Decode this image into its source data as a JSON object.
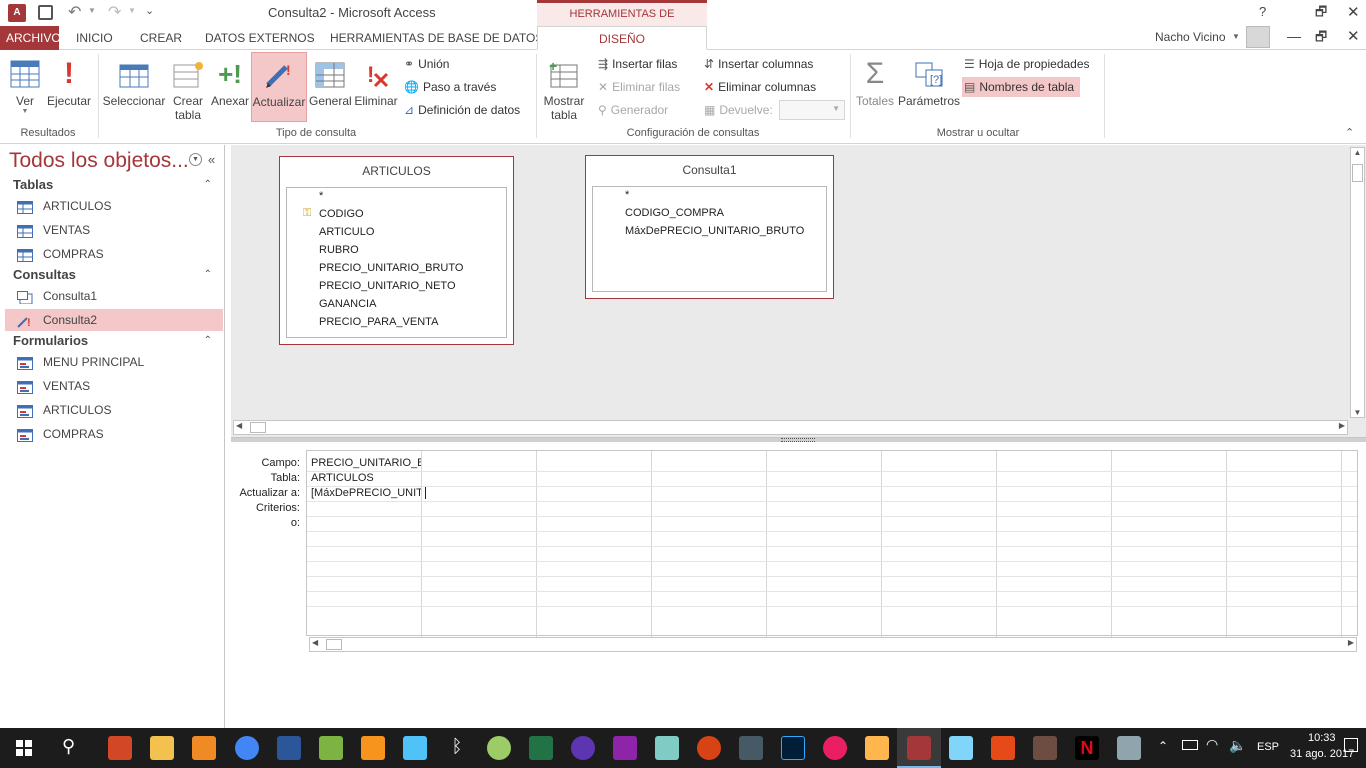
{
  "window": {
    "title": "Consulta2 - Microsoft Access",
    "context_tab": "HERRAMIENTAS DE CONSULTAS",
    "user": "Nacho Vicino",
    "help": "?"
  },
  "tabs": [
    "ARCHIVO",
    "INICIO",
    "CREAR",
    "DATOS EXTERNOS",
    "HERRAMIENTAS DE BASE DE DATOS",
    "DISEÑO"
  ],
  "ribbon": {
    "resultados": {
      "label": "Resultados",
      "ver": "Ver",
      "ejecutar": "Ejecutar"
    },
    "tipo": {
      "label": "Tipo de consulta",
      "seleccionar": "Seleccionar",
      "crear_tabla_1": "Crear",
      "crear_tabla_2": "tabla",
      "anexar": "Anexar",
      "actualizar": "Actualizar",
      "general": "General",
      "eliminar": "Eliminar",
      "union": "Unión",
      "paso": "Paso a través",
      "definicion": "Definición de datos"
    },
    "config": {
      "label": "Configuración de consultas",
      "mostrar_1": "Mostrar",
      "mostrar_2": "tabla",
      "insertar_filas": "Insertar filas",
      "eliminar_filas": "Eliminar filas",
      "generador": "Generador",
      "insertar_columnas": "Insertar columnas",
      "eliminar_columnas": "Eliminar columnas",
      "devuelve": "Devuelve:"
    },
    "mostrar": {
      "label": "Mostrar u ocultar",
      "totales": "Totales",
      "parametros": "Parámetros",
      "hoja": "Hoja de propiedades",
      "nombres": "Nombres de tabla"
    }
  },
  "nav": {
    "title": "Todos los objetos...",
    "sections": [
      {
        "name": "Tablas",
        "items": [
          "ARTICULOS",
          "VENTAS",
          "COMPRAS"
        ]
      },
      {
        "name": "Consultas",
        "items": [
          "Consulta1",
          "Consulta2"
        ]
      },
      {
        "name": "Formularios",
        "items": [
          "MENU PRINCIPAL",
          "VENTAS",
          "ARTICULOS",
          "COMPRAS"
        ]
      }
    ]
  },
  "design": {
    "table1": {
      "name": "ARTICULOS",
      "fields": [
        "*",
        "CODIGO",
        "ARTICULO",
        "RUBRO",
        "PRECIO_UNITARIO_BRUTO",
        "PRECIO_UNITARIO_NETO",
        "GANANCIA",
        "PRECIO_PARA_VENTA"
      ]
    },
    "table2": {
      "name": "Consulta1",
      "fields": [
        "*",
        "CODIGO_COMPRA",
        "MáxDePRECIO_UNITARIO_BRUTO"
      ]
    }
  },
  "grid": {
    "row_labels": [
      "Campo:",
      "Tabla:",
      "Actualizar a:",
      "Criterios:",
      "o:"
    ],
    "col1": [
      "PRECIO_UNITARIO_BRUTO",
      "ARTICULOS",
      "[MáxDePRECIO_UNITARIO_BRUTO]"
    ]
  },
  "taskbar": {
    "lang": "ESP",
    "time": "10:33",
    "date": "31 ago. 2017"
  }
}
